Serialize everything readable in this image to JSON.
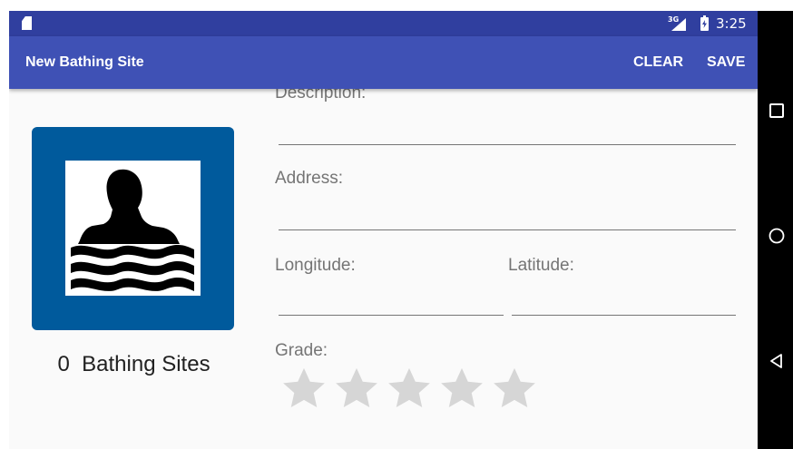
{
  "status_bar": {
    "network": "3G",
    "time": "3:25",
    "icons": [
      "sd-card-icon",
      "signal-icon",
      "battery-charging-icon"
    ]
  },
  "app_bar": {
    "title": "New Bathing Site",
    "clear_label": "CLEAR",
    "save_label": "SAVE"
  },
  "summary": {
    "count": "0",
    "label": "Bathing Sites",
    "image_icon": "swimming-sign-icon"
  },
  "form": {
    "description_label": "Description:",
    "description_value": "",
    "address_label": "Address:",
    "address_value": "",
    "longitude_label": "Longitude:",
    "longitude_value": "",
    "latitude_label": "Latitude:",
    "latitude_value": "",
    "grade_label": "Grade:",
    "grade_max": 5,
    "grade_value": 0
  },
  "colors": {
    "status_bar": "#303f9f",
    "app_bar": "#3f51b5",
    "sign_blue": "#005a9c",
    "star_empty": "#d6d6d6"
  },
  "nav_bar": {
    "icons": [
      "recents-icon",
      "home-icon",
      "back-icon"
    ]
  }
}
